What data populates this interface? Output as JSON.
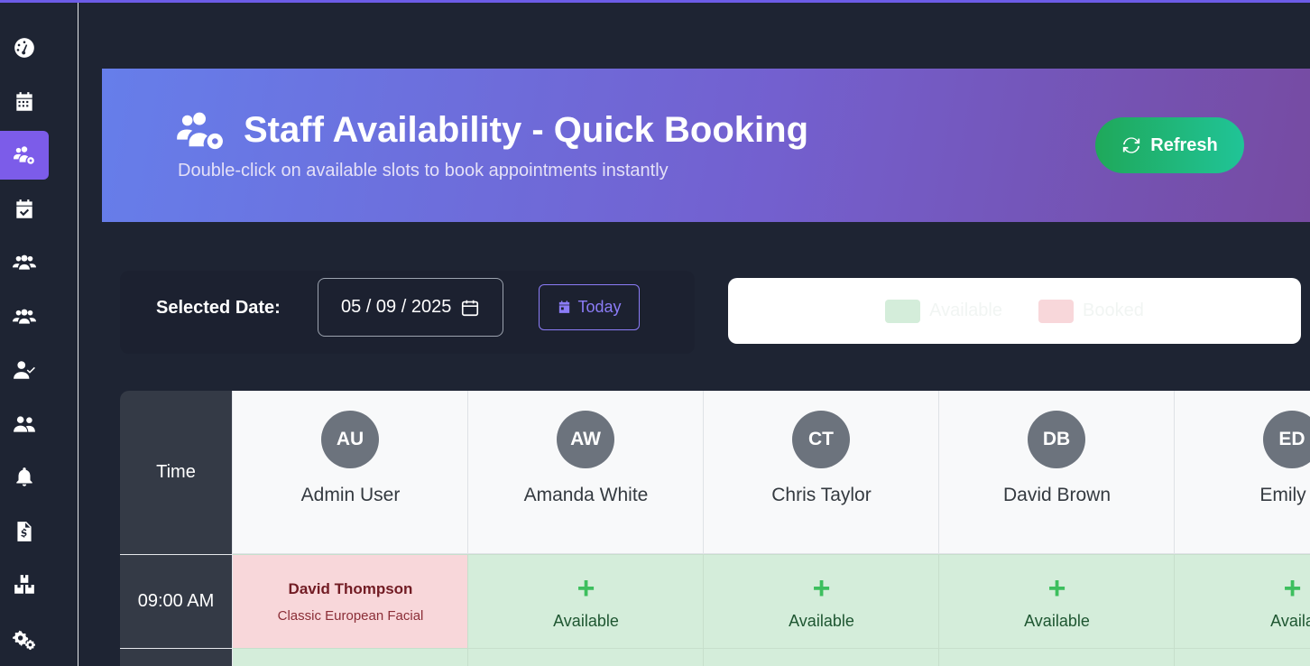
{
  "colors": {
    "accent": "#7c5ce9",
    "available": "#d4edda",
    "booked": "#f8d7da",
    "refresh": "#20c497"
  },
  "sidebar": {
    "items": [
      {
        "icon": "dashboard-icon",
        "active": false
      },
      {
        "icon": "calendar-icon",
        "active": false
      },
      {
        "icon": "staff-settings-icon",
        "active": true
      },
      {
        "icon": "calendar-check-icon",
        "active": false
      },
      {
        "icon": "users-icon",
        "active": false
      },
      {
        "icon": "users-group-icon",
        "active": false
      },
      {
        "icon": "user-check-icon",
        "active": false
      },
      {
        "icon": "user-friends-icon",
        "active": false
      },
      {
        "icon": "bell-icon",
        "active": false
      },
      {
        "icon": "invoice-icon",
        "active": false
      },
      {
        "icon": "boxes-icon",
        "active": false
      },
      {
        "icon": "cogs-icon",
        "active": false
      }
    ]
  },
  "header": {
    "title": "Staff Availability - Quick Booking",
    "subtitle": "Double-click on available slots to book appointments instantly",
    "refresh_label": "Refresh"
  },
  "controls": {
    "date_label": "Selected Date:",
    "date_value": "05 / 09 / 2025",
    "today_label": "Today"
  },
  "legend": {
    "available": "Available",
    "booked": "Booked"
  },
  "schedule": {
    "time_header": "Time",
    "staff": [
      {
        "initials": "AU",
        "name": "Admin User"
      },
      {
        "initials": "AW",
        "name": "Amanda White"
      },
      {
        "initials": "CT",
        "name": "Chris Taylor"
      },
      {
        "initials": "DB",
        "name": "David Brown"
      },
      {
        "initials": "ED",
        "name": "Emily D"
      }
    ],
    "rows": [
      {
        "time": "09:00 AM",
        "slots": [
          {
            "status": "booked",
            "client": "David Thompson",
            "service": "Classic European Facial"
          },
          {
            "status": "available",
            "label": "Available"
          },
          {
            "status": "available",
            "label": "Available"
          },
          {
            "status": "available",
            "label": "Available"
          },
          {
            "status": "available",
            "label": "Availa"
          }
        ]
      }
    ]
  }
}
